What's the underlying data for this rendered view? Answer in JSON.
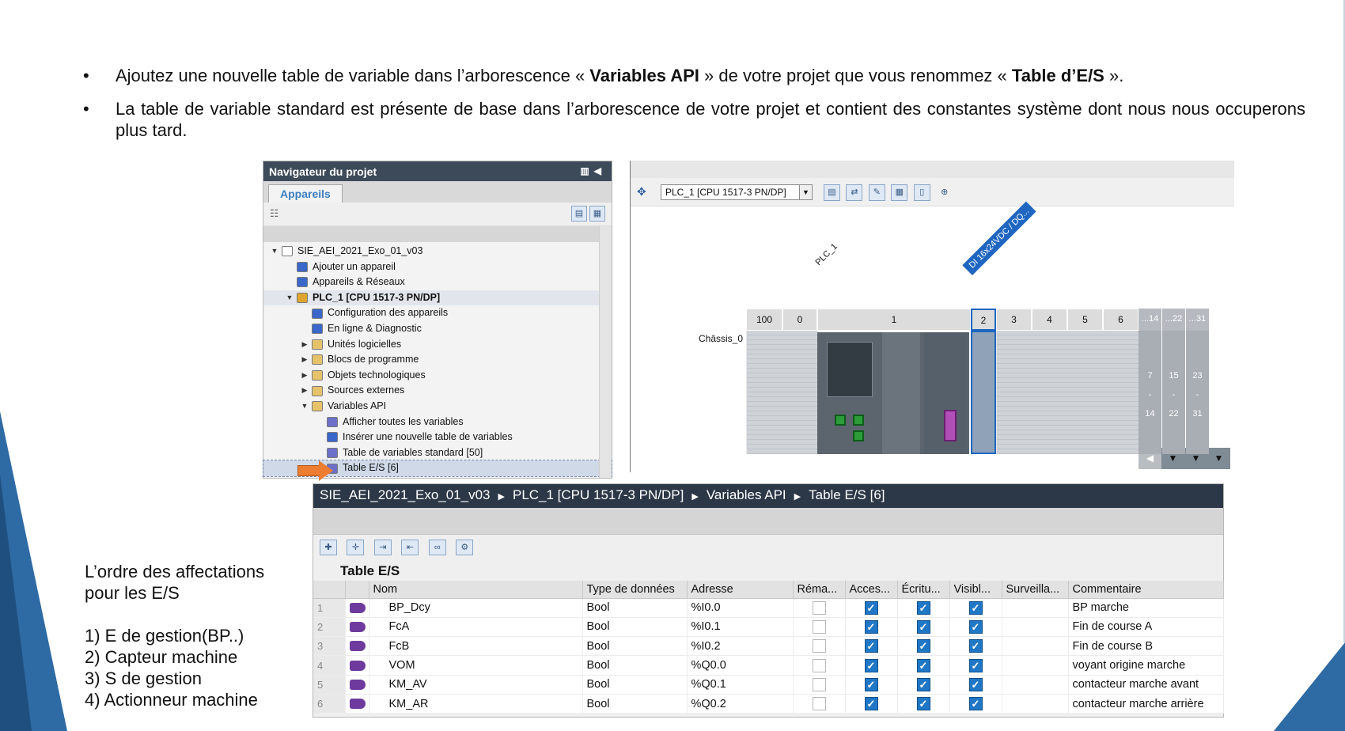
{
  "bullets": [
    {
      "pre": "Ajoutez une nouvelle table de variable dans l’arborescence « ",
      "bold1": "Variables API",
      "mid": " » de votre projet que vous renommez « ",
      "bold2": "Table d’E/S",
      "post": " »."
    },
    {
      "text": "La table de variable standard est présente de base dans l’arborescence de votre projet et contient des constantes système dont nous nous occuperons plus tard."
    }
  ],
  "navigator": {
    "title": "Navigateur du projet",
    "tab": "Appareils",
    "tree": [
      {
        "label": "SIE_AEI_2021_Exo_01_v03",
        "level": 0,
        "arrow": "open",
        "icon": "project-icon",
        "color": "#ffffff"
      },
      {
        "label": "Ajouter un appareil",
        "level": 1,
        "arrow": "",
        "icon": "add-device-icon",
        "color": "#3a67c9"
      },
      {
        "label": "Appareils & Réseaux",
        "level": 1,
        "arrow": "",
        "icon": "network-icon",
        "color": "#3a67c9"
      },
      {
        "label": "PLC_1 [CPU 1517-3 PN/DP]",
        "level": 1,
        "arrow": "open",
        "icon": "plc-icon",
        "color": "#e0a52e",
        "selected": true
      },
      {
        "label": "Configuration des appareils",
        "level": 2,
        "arrow": "",
        "icon": "config-icon",
        "color": "#3a67c9"
      },
      {
        "label": "En ligne & Diagnostic",
        "level": 2,
        "arrow": "",
        "icon": "diagnostic-icon",
        "color": "#3a67c9"
      },
      {
        "label": "Unités logicielles",
        "level": 2,
        "arrow": "closed",
        "icon": "folder-icon",
        "color": "#e6c36a"
      },
      {
        "label": "Blocs de programme",
        "level": 2,
        "arrow": "closed",
        "icon": "folder-icon",
        "color": "#e6c36a"
      },
      {
        "label": "Objets technologiques",
        "level": 2,
        "arrow": "closed",
        "icon": "folder-icon",
        "color": "#e6c36a"
      },
      {
        "label": "Sources externes",
        "level": 2,
        "arrow": "closed",
        "icon": "folder-icon",
        "color": "#e6c36a"
      },
      {
        "label": "Variables API",
        "level": 2,
        "arrow": "open",
        "icon": "folder-open-icon",
        "color": "#e6c36a"
      },
      {
        "label": "Afficher toutes les variables",
        "level": 3,
        "arrow": "",
        "icon": "variables-icon",
        "color": "#6d6fc8"
      },
      {
        "label": "Insérer une nouvelle table de variables",
        "level": 3,
        "arrow": "",
        "icon": "insert-table-icon",
        "color": "#3a67c9"
      },
      {
        "label": "Table de variables standard [50]",
        "level": 3,
        "arrow": "",
        "icon": "table-icon",
        "color": "#6d6fc8"
      },
      {
        "label": "Table E/S [6]",
        "level": 3,
        "arrow": "",
        "icon": "table-icon",
        "color": "#6d6fc8",
        "highlighted": true
      }
    ]
  },
  "device": {
    "select": "PLC_1 [CPU 1517-3 PN/DP]",
    "plc_label": "PLC_1",
    "di_label": "DI 16x24VDC / DQ...",
    "chassis": "Châssis_0",
    "slots": [
      "100",
      "0",
      "1",
      "2",
      "3",
      "4",
      "5",
      "6"
    ],
    "extra_slots_head": [
      "...14",
      "...22",
      "...31"
    ],
    "extra_slots_top": [
      "7",
      "15",
      "23"
    ],
    "extra_slots_mid": [
      "-",
      "-",
      "-"
    ],
    "extra_slots_bot": [
      "14",
      "22",
      "31"
    ]
  },
  "vartable": {
    "breadcrumb": [
      "SIE_AEI_2021_Exo_01_v03",
      "PLC_1 [CPU 1517-3 PN/DP]",
      "Variables API",
      "Table E/S [6]"
    ],
    "title": "Table E/S",
    "columns": [
      "",
      "",
      "Nom",
      "Type de données",
      "Adresse",
      "Réma...",
      "Acces...",
      "Écritu...",
      "Visibl...",
      "Surveilla...",
      "Commentaire"
    ],
    "rows": [
      {
        "n": "1",
        "name": "BP_Dcy",
        "type": "Bool",
        "addr": "%I0.0",
        "comment": "BP marche"
      },
      {
        "n": "2",
        "name": "FcA",
        "type": "Bool",
        "addr": "%I0.1",
        "comment": "Fin de course A"
      },
      {
        "n": "3",
        "name": "FcB",
        "type": "Bool",
        "addr": "%I0.2",
        "comment": "Fin de course B"
      },
      {
        "n": "4",
        "name": "VOM",
        "type": "Bool",
        "addr": "%Q0.0",
        "comment": "voyant origine marche"
      },
      {
        "n": "5",
        "name": "KM_AV",
        "type": "Bool",
        "addr": "%Q0.1",
        "comment": "contacteur marche avant"
      },
      {
        "n": "6",
        "name": "KM_AR",
        "type": "Bool",
        "addr": "%Q0.2",
        "comment": "contacteur marche arrière"
      }
    ]
  },
  "order": {
    "heading1": "L’ordre des affectations",
    "heading2": "pour les E/S",
    "items": [
      "1) E de gestion(BP..)",
      "2) Capteur machine",
      "3) S  de gestion",
      "4) Actionneur machine"
    ]
  },
  "colors": {
    "accent_blue": "#2e6aa3",
    "checkbox_blue": "#1f77c6",
    "path_bar": "#2c3848"
  }
}
